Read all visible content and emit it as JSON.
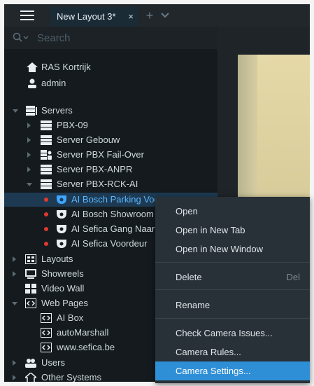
{
  "tab": {
    "title": "New Layout 3*",
    "close": "×",
    "add": "+"
  },
  "search": {
    "placeholder": "Search"
  },
  "tree": {
    "site": "RAS Kortrijk",
    "user": "admin",
    "servers_label": "Servers",
    "servers": [
      "PBX-09",
      "Server Gebouw",
      "Server PBX Fail-Over",
      "Server PBX-ANPR",
      "Server PBX-RCK-AI"
    ],
    "cameras": [
      "AI Bosch Parking Vooraan",
      "AI Bosch Showroom",
      "AI Sefica Gang Naar",
      "AI Sefica Voordeur"
    ],
    "layouts": "Layouts",
    "showreels": "Showreels",
    "video_wall": "Video Wall",
    "web_pages": "Web Pages",
    "web_pages_items": [
      "AI Box",
      "autoMarshall",
      "www.sefica.be"
    ],
    "users": "Users",
    "other_systems": "Other Systems"
  },
  "context_menu": {
    "open": "Open",
    "open_new_tab": "Open in New Tab",
    "open_new_window": "Open in New Window",
    "delete": "Delete",
    "delete_shortcut": "Del",
    "rename": "Rename",
    "check_camera_issues": "Check Camera Issues...",
    "camera_rules": "Camera Rules...",
    "camera_settings": "Camera Settings..."
  },
  "colors": {
    "accent": "#2f8fd6",
    "selection": "#1d3a52",
    "recording": "#e0392f",
    "camera_icon": "#3ea6ff"
  }
}
